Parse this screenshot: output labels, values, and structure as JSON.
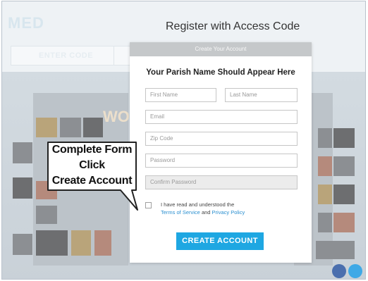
{
  "page": {
    "title": "Register with Access Code"
  },
  "background": {
    "logo_text": "MED",
    "enter_code_label": "ENTER CODE",
    "banner_text": "WO"
  },
  "modal": {
    "header": "Create Your Account",
    "parish_name": "Your Parish Name Should Appear Here",
    "fields": {
      "first_name": "First Name",
      "last_name": "Last Name",
      "email": "Email",
      "zip": "Zip Code",
      "password": "Password",
      "confirm_password": "Confirm Password"
    },
    "terms": {
      "line1": "I have read and understood the",
      "terms_link": "Terms of Service",
      "and": " and ",
      "privacy_link": "Privacy Policy"
    },
    "submit_label": "CREATE ACCOUNT"
  },
  "callout": {
    "line1": "Complete Form",
    "line2": "Click",
    "line3": "Create Account"
  },
  "colors": {
    "accent": "#1ea7e2",
    "link": "#2a8fd0",
    "header": "#c5c8ca"
  }
}
